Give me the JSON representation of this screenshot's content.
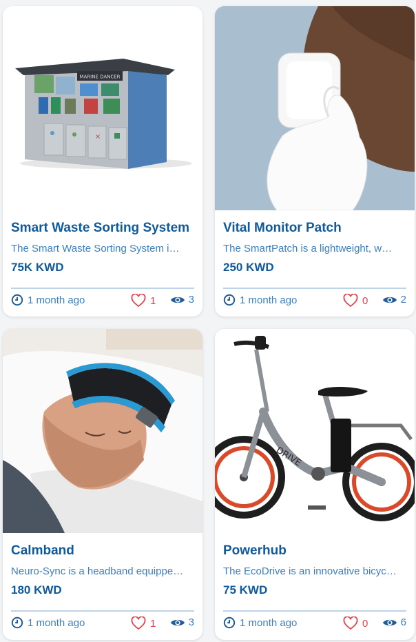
{
  "cards": [
    {
      "title": "Smart Waste Sorting System",
      "description": "The Smart Waste Sorting System i…",
      "price": "75K KWD",
      "time": "1 month ago",
      "likes": "1",
      "views": "3",
      "image_subject": "waste-sorting-kiosk"
    },
    {
      "title": "Vital Monitor Patch",
      "description": "The SmartPatch is a lightweight, w…",
      "price": "250 KWD",
      "time": "1 month ago",
      "likes": "0",
      "views": "2",
      "image_subject": "patch-on-arm"
    },
    {
      "title": "Calmband",
      "description": "Neuro-Sync is a headband equippe…",
      "price": "180 KWD",
      "time": "1 month ago",
      "likes": "1",
      "views": "3",
      "image_subject": "man-sleeping-with-headband"
    },
    {
      "title": "Powerhub",
      "description": "The EcoDrive is an innovative bicyc…",
      "price": "75 KWD",
      "time": "1 month ago",
      "likes": "0",
      "views": "6",
      "image_subject": "electric-bicycle"
    }
  ],
  "kiosk_sign": "MARINE DANCER",
  "icons": {
    "time": "clock-icon",
    "likes": "heart-icon",
    "views": "eye-icon"
  },
  "colors": {
    "title": "#0f5a9c",
    "text": "#3b7fbf",
    "like": "#e2434e",
    "divider": "#bcd3e8",
    "card_bg": "#ffffff"
  }
}
